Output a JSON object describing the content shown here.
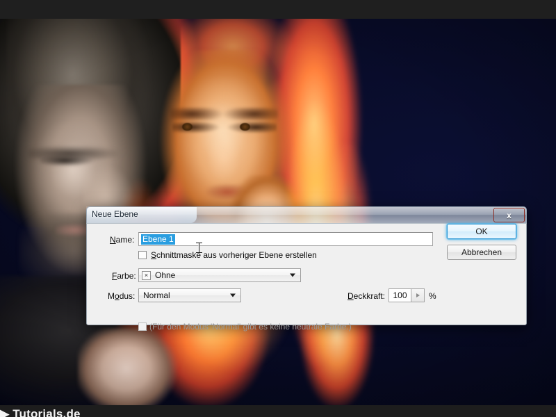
{
  "window": {
    "app_chrome": {
      "watermark": "▶ Tutorials.de"
    }
  },
  "canvas": {
    "description": "Photo composite of a dark-haired man on the left and a woman with fiery orange hair on a dark navy background",
    "colors": {
      "background_navy": "#05061c",
      "flame_orange": "#ff7a16",
      "flame_highlight": "#ffd37a",
      "skin_warm": "#f7cfa6"
    }
  },
  "dialog": {
    "title": "Neue Ebene",
    "close_icon_label": "x",
    "fields": {
      "name_label": "Name:",
      "name_label_accel": "N",
      "name_value": "Ebene 1",
      "clipping_mask_label": "Schnittmaske aus vorheriger Ebene erstellen",
      "clipping_mask_accel": "S",
      "clipping_mask_checked": "false",
      "color_label": "Farbe:",
      "color_label_accel": "F",
      "color_value": "Ohne",
      "color_swatch_glyph": "×",
      "mode_label": "Modus:",
      "mode_label_accel": "o",
      "mode_value": "Normal",
      "opacity_label": "Deckkraft:",
      "opacity_label_accel": "D",
      "opacity_value": "100",
      "opacity_unit": "%",
      "neutral_color_note": "(Für den Modus 'Normal' gibt es keine neutrale Farbe.)",
      "neutral_color_checked": "false",
      "neutral_color_enabled": "false"
    },
    "buttons": {
      "ok": "OK",
      "cancel": "Abbrechen"
    },
    "accent_colors": {
      "selection_blue": "#2a9ee0",
      "focus_glow_blue": "#4eb4e9",
      "close_red": "#d8503c",
      "dialog_face": "#f0f0f0"
    }
  }
}
